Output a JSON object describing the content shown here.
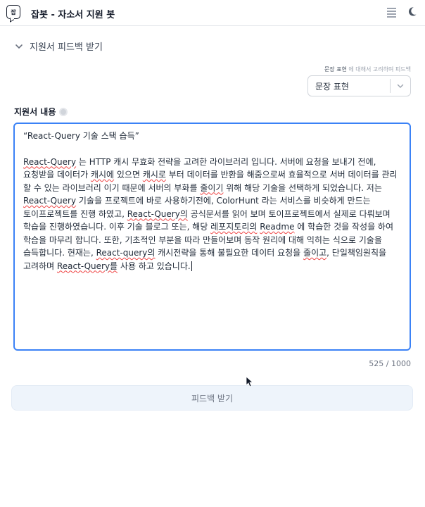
{
  "app": {
    "title": "잡봇 - 자소서 지원 봇",
    "logo_text": "잡"
  },
  "section": {
    "title": "지원서 피드백 받기"
  },
  "hint": {
    "strong": "문장 표현",
    "rest": "에 대해서 고려하며 피드백"
  },
  "select": {
    "value": "문장 표현"
  },
  "field": {
    "label": "지원서 내용"
  },
  "textarea": {
    "title": "“React-Query 기술 스택 습득”",
    "segments": [
      {
        "t": "React-Query",
        "u": true
      },
      {
        "t": " 는 HTTP 캐시 무효화 전략을 고려한 라이브러리 입니다. 서버에 요청을 보내기 전에, 요청받을 데이터가 ",
        "u": false
      },
      {
        "t": "캐시에",
        "u": true
      },
      {
        "t": " 있으면 ",
        "u": false
      },
      {
        "t": "캐시로",
        "u": true
      },
      {
        "t": " 부터 데이터를 반환을 해줌으로써 효율적으로 서버 데이터를 관리 할 수 있는 라이브러리 이기 때문에 서버의 부화를 ",
        "u": false
      },
      {
        "t": "줄이기",
        "u": true
      },
      {
        "t": " 위해 해당 기술을 선택하게 되었습니다. 저는 ",
        "u": false
      },
      {
        "t": "React-Query",
        "u": true
      },
      {
        "t": " 기술을 프로젝트에 바로 사용하기전에, ColorHunt 라는 서비스를 비슷하게 만드는 토이프로젝트를 진행 하였고, ",
        "u": false
      },
      {
        "t": "React-Query의",
        "u": true
      },
      {
        "t": " 공식문서를 읽어 보며 토이프로젝트에서 실제로 다뤄보며 학습을 진행하였습니다. 이후 기술 블로그 또는, 해당 ",
        "u": false
      },
      {
        "t": "레포지토리의",
        "u": true
      },
      {
        "t": " ",
        "u": false
      },
      {
        "t": "Readme",
        "u": true
      },
      {
        "t": " 에 학습한 것을 작성을 하여 학습을 마무리 합니다. 또한, 기초적인 부분을 따라 만들어보며 동작 원리에 대해 익히는 식으로 기술을 습득합니다. 현재는, ",
        "u": false
      },
      {
        "t": "React-query의",
        "u": true
      },
      {
        "t": " 캐시전략을 통해 불필요한 데이터 요청을 ",
        "u": false
      },
      {
        "t": "줄이고",
        "u": true
      },
      {
        "t": ", 단일책임원칙을 고려하며 ",
        "u": false
      },
      {
        "t": "React-Query를",
        "u": true
      },
      {
        "t": " 사용 하고 있습니다.",
        "u": false
      }
    ]
  },
  "counter": {
    "text": "525 / 1000"
  },
  "submit": {
    "label": "피드백 받기"
  }
}
